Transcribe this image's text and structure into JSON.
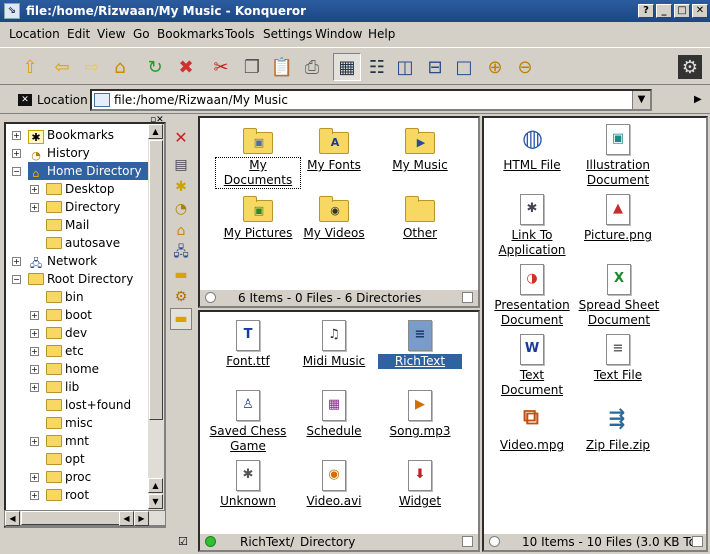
{
  "window": {
    "title": "file:/home/Rizwaan/My Music - Konqueror"
  },
  "menu": [
    "Location",
    "Edit",
    "View",
    "Go",
    "Bookmarks",
    "Tools",
    "Settings",
    "Window",
    "Help"
  ],
  "locationbar": {
    "label": "Location",
    "url": "file:/home/Rizwaan/My Music"
  },
  "tree": {
    "nodes": [
      {
        "label": "Bookmarks"
      },
      {
        "label": "History"
      },
      {
        "label": "Home Directory"
      },
      {
        "label": "Desktop"
      },
      {
        "label": "Directory"
      },
      {
        "label": "Mail"
      },
      {
        "label": "autosave"
      },
      {
        "label": "Network"
      },
      {
        "label": "Root Directory"
      },
      {
        "label": "bin"
      },
      {
        "label": "boot"
      },
      {
        "label": "dev"
      },
      {
        "label": "etc"
      },
      {
        "label": "home"
      },
      {
        "label": "lib"
      },
      {
        "label": "lost+found"
      },
      {
        "label": "misc"
      },
      {
        "label": "mnt"
      },
      {
        "label": "opt"
      },
      {
        "label": "proc"
      },
      {
        "label": "root"
      }
    ]
  },
  "pane_topleft": {
    "items": [
      {
        "label": "My\nDocuments"
      },
      {
        "label": "My Fonts"
      },
      {
        "label": "My Music"
      },
      {
        "label": "My Pictures"
      },
      {
        "label": "My Videos"
      },
      {
        "label": "Other"
      }
    ],
    "status": "6 Items - 0 Files - 6 Directories"
  },
  "pane_bottomleft": {
    "items": [
      {
        "label": "Font.ttf"
      },
      {
        "label": "Midi Music"
      },
      {
        "label": "RichText"
      },
      {
        "label": "Saved Chess\nGame"
      },
      {
        "label": "Schedule"
      },
      {
        "label": "Song.mp3"
      },
      {
        "label": "Unknown"
      },
      {
        "label": "Video.avi"
      },
      {
        "label": "Widget"
      }
    ],
    "status_name": "RichText/",
    "status_type": "Directory"
  },
  "pane_right": {
    "items": [
      {
        "label": "HTML File"
      },
      {
        "label": "Illustration\nDocument"
      },
      {
        "label": "Link To\nApplication"
      },
      {
        "label": "Picture.png"
      },
      {
        "label": "Presentation\nDocument"
      },
      {
        "label": "Spread Sheet\nDocument"
      },
      {
        "label": "Text\nDocument"
      },
      {
        "label": "Text File"
      },
      {
        "label": "Video.mpg"
      },
      {
        "label": "Zip File.zip"
      }
    ],
    "status": "10 Items - 10 Files (3.0 KB To"
  }
}
